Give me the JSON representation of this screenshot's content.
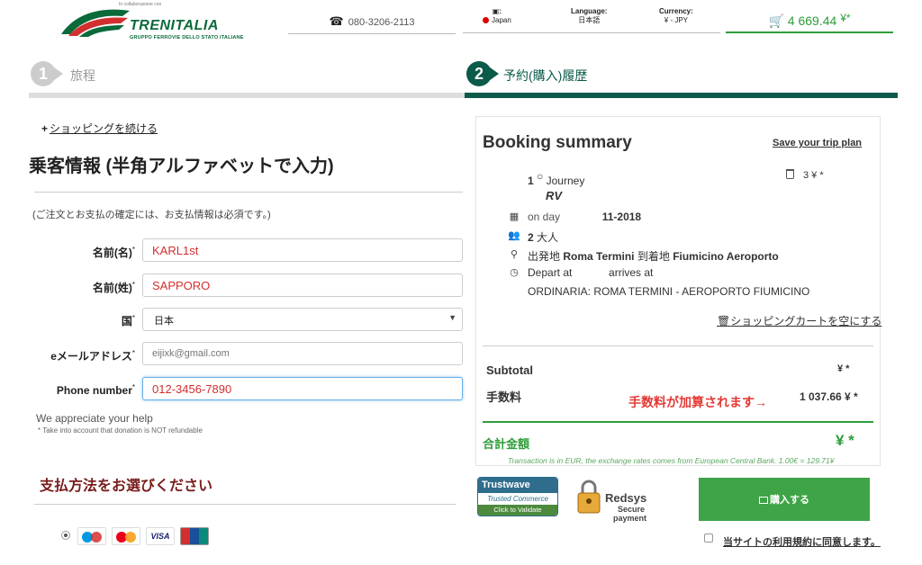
{
  "header": {
    "logo_brand": "TRENITALIA",
    "logo_sub": "GRUPPO FERROVIE DELLO STATO ITALIANE",
    "logo_collab": "In collaborazione con",
    "phone": "080-3206-2113",
    "country_label": "Japan",
    "language_title": "Language:",
    "language_value": "日本語",
    "currency_title": "Currency:",
    "currency_value": "¥ - JPY",
    "cart_total": "4 669.44",
    "cart_currency": "¥*"
  },
  "steps": [
    {
      "num": "1",
      "label": "旅程"
    },
    {
      "num": "2",
      "label": "予約(購入)履歴"
    }
  ],
  "form": {
    "continue_link": "ショッピングを続ける",
    "title": "乗客情報 (半角アルファベットで入力)",
    "note": "(ご注文とお支払の確定には、お支払情報は必須です。)",
    "fields": {
      "first_name_label": "名前(名)",
      "first_name_value": "KARL1st",
      "last_name_label": "名前(姓)",
      "last_name_value": "SAPPORO",
      "country_label": "国",
      "country_value": "日本",
      "email_label": "eメールアドレス",
      "email_placeholder": "eijixk@gmail.com",
      "phone_label": "Phone number",
      "phone_value": "012-3456-7890",
      "required_mark": "*"
    },
    "appreciate": "We appreciate your help",
    "appreciate_note": "* Take into account that donation is NOT refundable",
    "payment_title": "支払方法をお選びください",
    "cards": [
      "Maestro",
      "MasterCard",
      "VISA",
      "UnionPay"
    ]
  },
  "summary": {
    "title": "Booking summary",
    "save_link": "Save your trip plan",
    "journey_num": "1",
    "journey_label": "Journey",
    "journey_price": "3 ¥ *",
    "train_code": "RV",
    "date_prefix": "on day",
    "date_value": "11-2018",
    "passengers_num": "2",
    "passengers_label": "大人",
    "from_label": "出発地",
    "from_station": "Roma Termini",
    "to_label": "到着地",
    "to_station": "Fiumicino Aeroporto",
    "depart_label": "Depart at",
    "arrive_label": "arrives at",
    "fare": "ORDINARIA: ROMA TERMINI - AEROPORTO FIUMICINO",
    "empty_cart": "ショッピングカートを空にする",
    "subtotal_label": "Subtotal",
    "subtotal_value": "¥ *",
    "fee_label": "手数料",
    "fee_note": "手数料が加算されます→",
    "fee_value": "1 037.66 ¥ *",
    "total_label": "合計金額",
    "total_value": "¥ *",
    "rate_note": "Transaction is in EUR, the exchange rates comes from European Central Bank. 1.00€ = 129.71¥"
  },
  "badges": {
    "trustwave_top": "Trustwave",
    "trustwave_mid": "Trusted Commerce",
    "trustwave_bot": "Click to Validate",
    "redsys_name": "Redsys",
    "redsys_secure": "Secure",
    "redsys_payment": "payment"
  },
  "buy_button": "購入する",
  "terms_label": "当サイトの利用規約に同意します。",
  "colors": {
    "brand_green": "#2e9d3a",
    "dark_teal": "#0b5a4a",
    "maroon": "#7a1c1c",
    "red_text": "#d32f2f"
  }
}
